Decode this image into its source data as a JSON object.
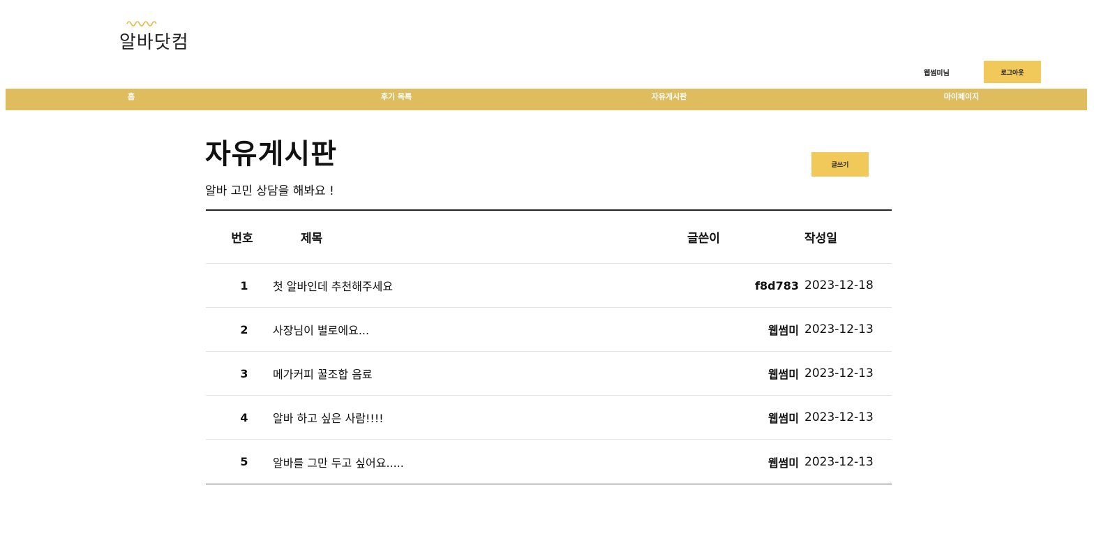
{
  "logo": {
    "text": "알바닷컴"
  },
  "header": {
    "user_name": "웹썸미님",
    "logout_label": "로그아웃"
  },
  "nav": {
    "items": [
      {
        "label": "홈"
      },
      {
        "label": "후기 목록"
      },
      {
        "label": "자유게시판"
      },
      {
        "label": "마이페이지"
      }
    ]
  },
  "main": {
    "title": "자유게시판",
    "subtitle": "알바 고민 상담을 해봐요 !",
    "write_label": "글쓰기"
  },
  "table": {
    "headers": {
      "num": "번호",
      "title": "제목",
      "author": "글쓴이",
      "date": "작성일"
    },
    "rows": [
      {
        "num": "1",
        "title": "첫 알바인데 추천해주세요",
        "author": "f8d783",
        "date": "2023-12-18"
      },
      {
        "num": "2",
        "title": "사장님이 별로에요...",
        "author": "웹썸미",
        "date": "2023-12-13"
      },
      {
        "num": "3",
        "title": "메가커피 꿀조합 음료",
        "author": "웹썸미",
        "date": "2023-12-13"
      },
      {
        "num": "4",
        "title": "알바 하고 싶은 사람!!!!",
        "author": "웹썸미",
        "date": "2023-12-13"
      },
      {
        "num": "5",
        "title": "알바를 그만 두고 싶어요.....",
        "author": "웹썸미",
        "date": "2023-12-13"
      }
    ]
  },
  "colors": {
    "accent": "#dfbc5e",
    "button": "#f0c95a"
  }
}
